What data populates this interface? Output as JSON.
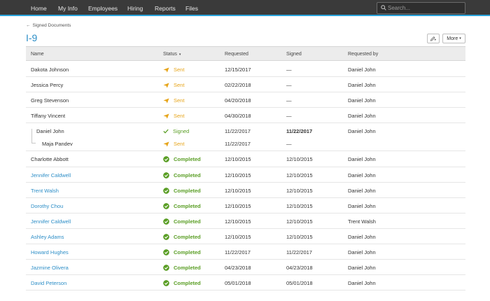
{
  "nav": {
    "items": [
      "Home",
      "My Info",
      "Employees",
      "Hiring",
      "Reports",
      "Files"
    ],
    "search_placeholder": "Search..."
  },
  "breadcrumb": {
    "arrow": "←",
    "label": "Signed Documents"
  },
  "page": {
    "title": "I-9"
  },
  "toolbar": {
    "more_label": "More",
    "more_caret": "▾"
  },
  "table": {
    "headers": {
      "name": "Name",
      "status": "Status",
      "status_caret": "▾",
      "requested": "Requested",
      "signed": "Signed",
      "requested_by": "Requested by"
    },
    "rows": [
      {
        "name": "Dakota Johnson",
        "status": "Sent",
        "requested": "12/15/2017",
        "signed": "—",
        "by": "Daniel John"
      },
      {
        "name": "Jessica Percy",
        "status": "Sent",
        "requested": "02/22/2018",
        "signed": "—",
        "by": "Daniel John"
      },
      {
        "name": "Greg Stevenson",
        "status": "Sent",
        "requested": "04/20/2018",
        "signed": "—",
        "by": "Daniel John"
      },
      {
        "name": "Tiffany Vincent",
        "status": "Sent",
        "requested": "04/30/2018",
        "signed": "—",
        "by": "Daniel John"
      },
      {
        "name": "Daniel John",
        "status": "Signed",
        "requested": "11/22/2017",
        "signed": "11/22/2017",
        "by": "Daniel John"
      },
      {
        "name": "Maja Pandev",
        "status": "Sent",
        "requested": "11/22/2017",
        "signed": "—",
        "by": ""
      },
      {
        "name": "Charlotte Abbott",
        "status": "Completed",
        "requested": "12/10/2015",
        "signed": "12/10/2015",
        "by": "Daniel John"
      },
      {
        "name": "Jennifer Caldwell",
        "status": "Completed",
        "requested": "12/10/2015",
        "signed": "12/10/2015",
        "by": "Daniel John"
      },
      {
        "name": "Trent Walsh",
        "status": "Completed",
        "requested": "12/10/2015",
        "signed": "12/10/2015",
        "by": "Daniel John"
      },
      {
        "name": "Dorothy Chou",
        "status": "Completed",
        "requested": "12/10/2015",
        "signed": "12/10/2015",
        "by": "Daniel John"
      },
      {
        "name": "Jennifer Caldwell",
        "status": "Completed",
        "requested": "12/10/2015",
        "signed": "12/10/2015",
        "by": "Trent Walsh"
      },
      {
        "name": "Ashley Adams",
        "status": "Completed",
        "requested": "12/10/2015",
        "signed": "12/10/2015",
        "by": "Daniel John"
      },
      {
        "name": "Howard Hughes",
        "status": "Completed",
        "requested": "11/22/2017",
        "signed": "11/22/2017",
        "by": "Daniel John"
      },
      {
        "name": "Jazmine Olivera",
        "status": "Completed",
        "requested": "04/23/2018",
        "signed": "04/23/2018",
        "by": "Daniel John"
      },
      {
        "name": "David Peterson",
        "status": "Completed",
        "requested": "05/01/2018",
        "signed": "05/01/2018",
        "by": "Daniel John"
      }
    ]
  },
  "colors": {
    "nav_bg": "#3a3a3a",
    "accent_blue": "#2d8ec7",
    "sent_orange": "#e6a419",
    "completed_green": "#5a9e25"
  }
}
